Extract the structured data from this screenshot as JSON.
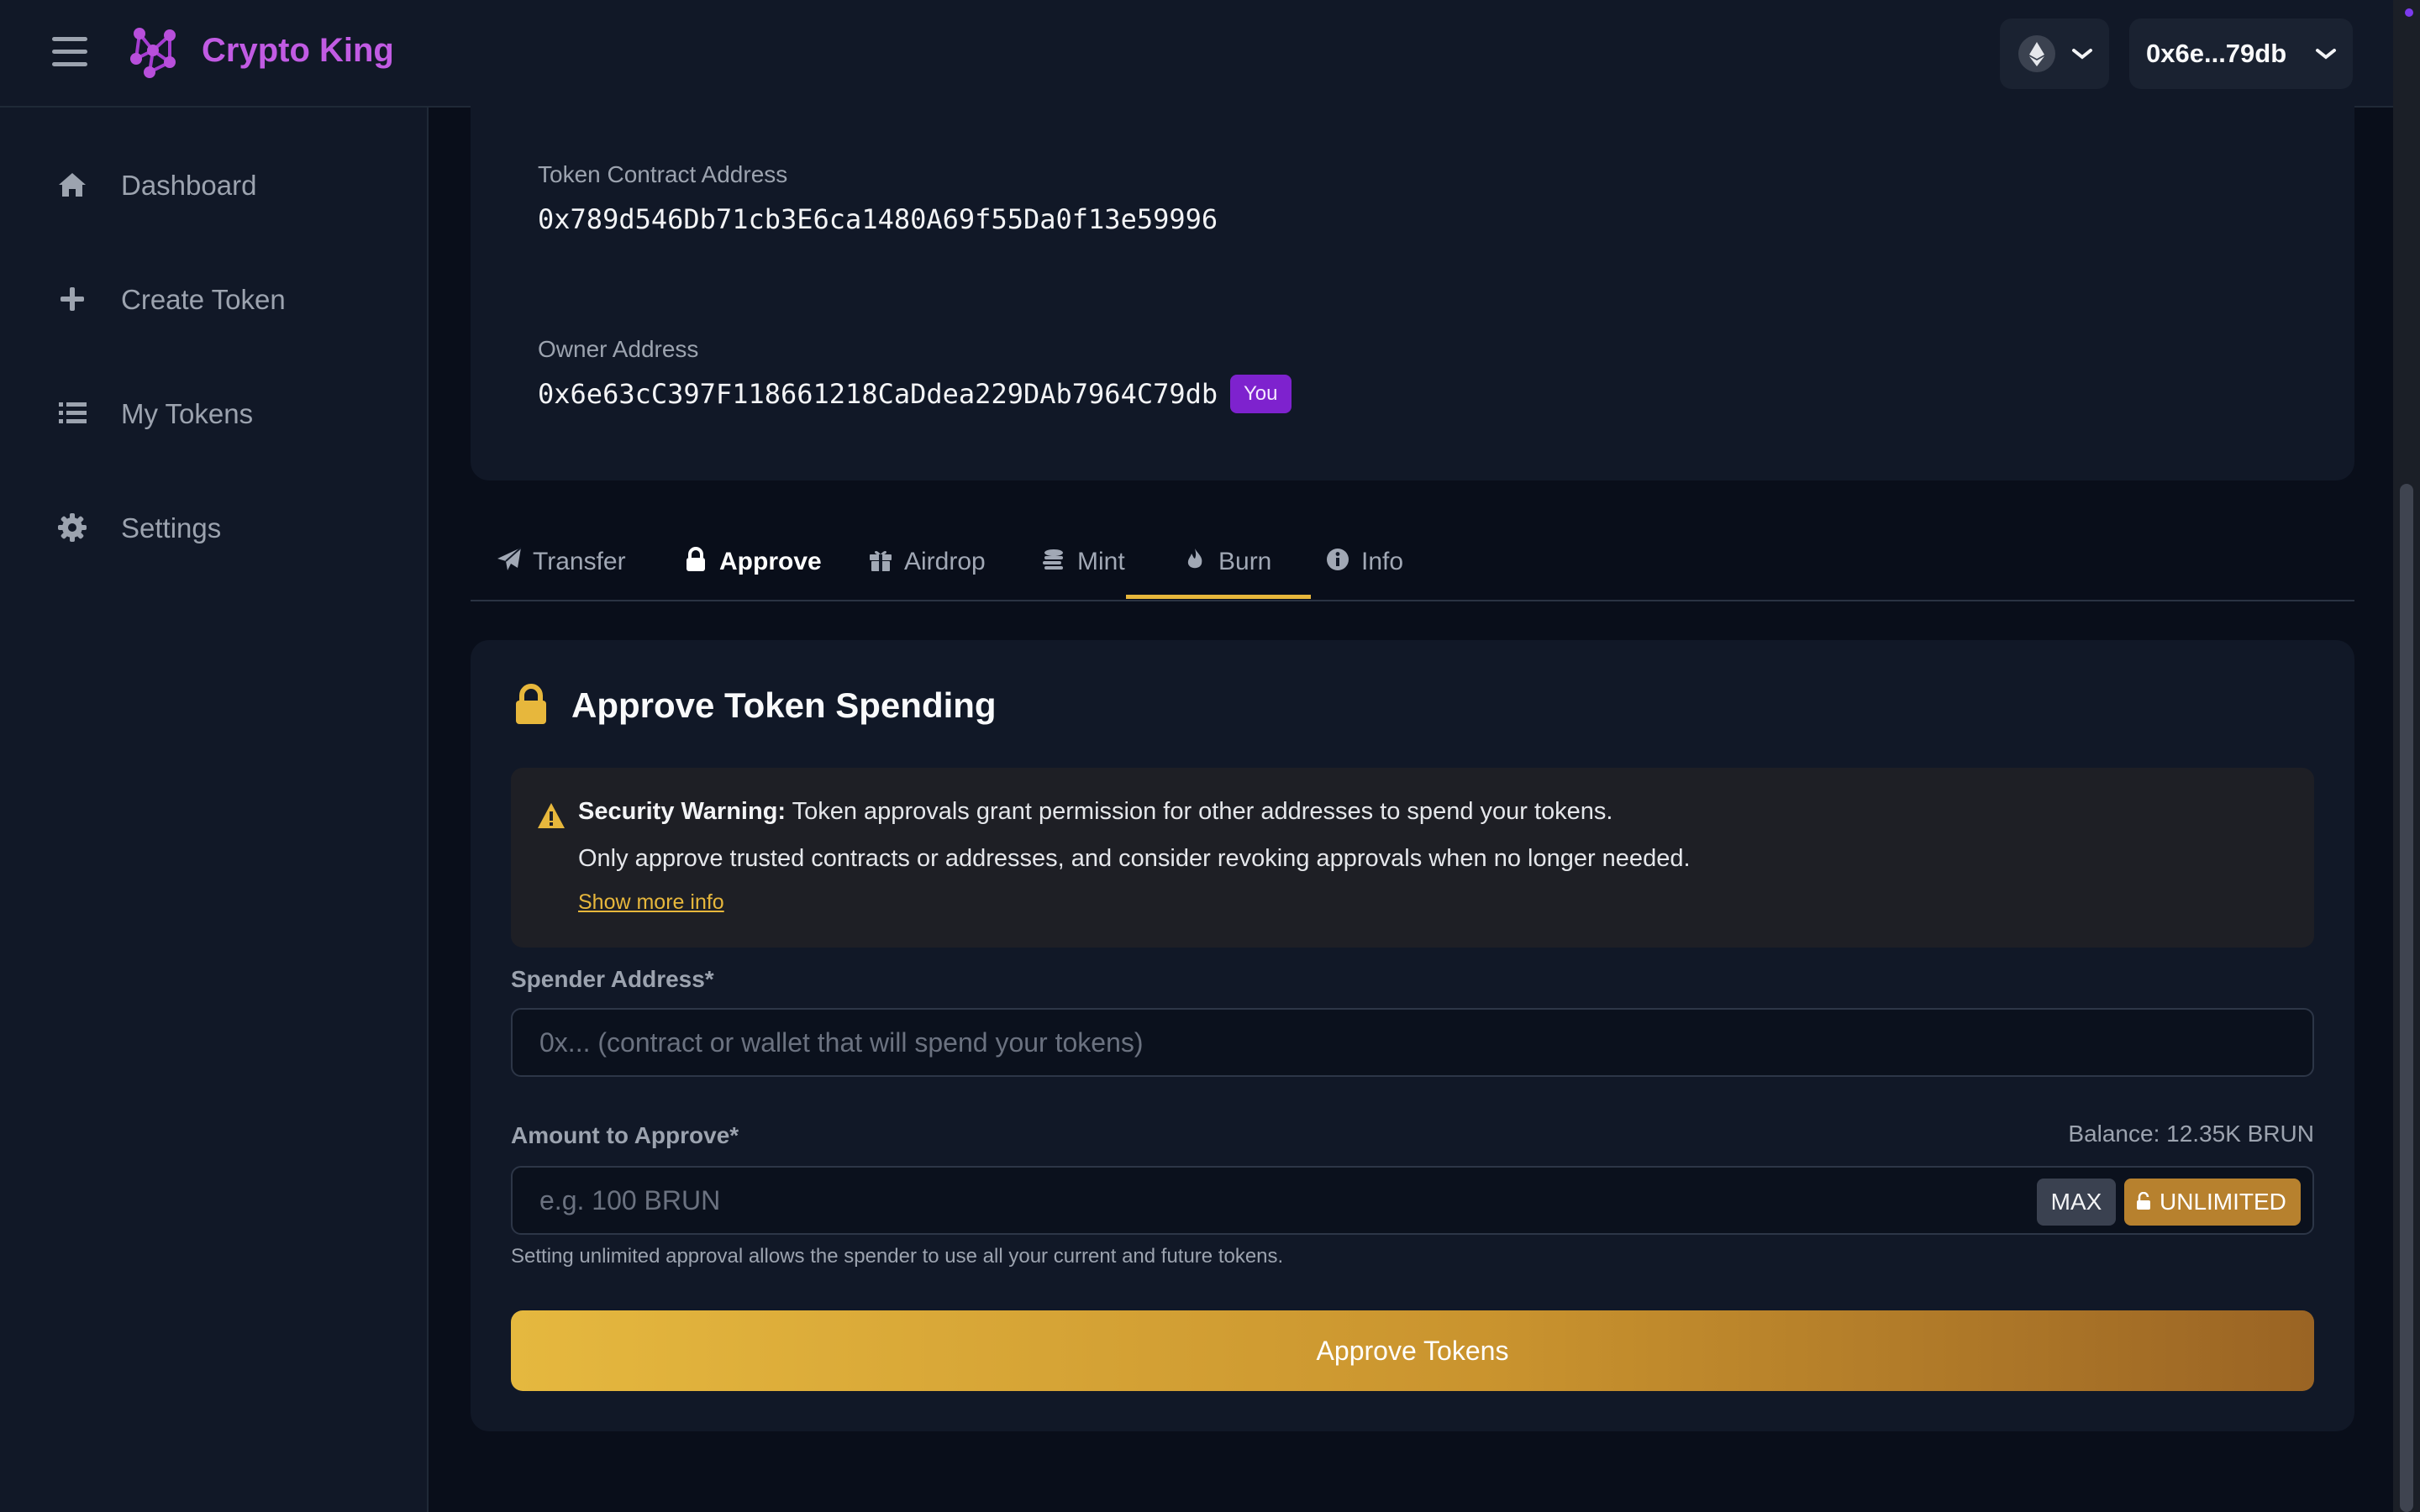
{
  "app": {
    "title": "Crypto King"
  },
  "header": {
    "network_icon": "ethereum-icon",
    "account_label": "0x6e...79db"
  },
  "sidebar": {
    "items": [
      {
        "label": "Dashboard",
        "icon": "home-icon"
      },
      {
        "label": "Create Token",
        "icon": "plus-icon"
      },
      {
        "label": "My Tokens",
        "icon": "list-icon"
      },
      {
        "label": "Settings",
        "icon": "gear-icon"
      }
    ]
  },
  "token_info": {
    "contract_label": "Token Contract Address",
    "contract_value": "0x789d546Db71cb3E6ca1480A69f55Da0f13e59996",
    "owner_label": "Owner Address",
    "owner_value": "0x6e63cC397F118661218CaDdea229DAb7964C79db",
    "owner_badge": "You"
  },
  "tabs": [
    {
      "label": "Transfer",
      "icon": "paper-plane-icon"
    },
    {
      "label": "Approve",
      "icon": "lock-icon",
      "active": true
    },
    {
      "label": "Airdrop",
      "icon": "gift-icon"
    },
    {
      "label": "Mint",
      "icon": "coins-icon"
    },
    {
      "label": "Burn",
      "icon": "fire-icon"
    },
    {
      "label": "Info",
      "icon": "info-icon"
    }
  ],
  "approve": {
    "title": "Approve Token Spending",
    "warning": {
      "bold": "Security Warning:",
      "line1": " Token approvals grant permission for other addresses to spend your tokens.",
      "line2": "Only approve trusted contracts or addresses, and consider revoking approvals when no longer needed.",
      "link": "Show more info"
    },
    "spender_label": "Spender Address*",
    "spender_placeholder": "0x... (contract or wallet that will spend your tokens)",
    "amount_label": "Amount to Approve*",
    "balance": "Balance: 12.35K BRUN",
    "amount_placeholder": "e.g. 100 BRUN",
    "max_label": "MAX",
    "unlimited_label": "UNLIMITED",
    "hint": "Setting unlimited approval allows the spender to use all your current and future tokens.",
    "submit_label": "Approve Tokens"
  },
  "colors": {
    "accent": "#e7b73c",
    "brand": "#c15be3",
    "badge": "#7e22ce",
    "background": "#090e1a",
    "panel": "#111827"
  }
}
